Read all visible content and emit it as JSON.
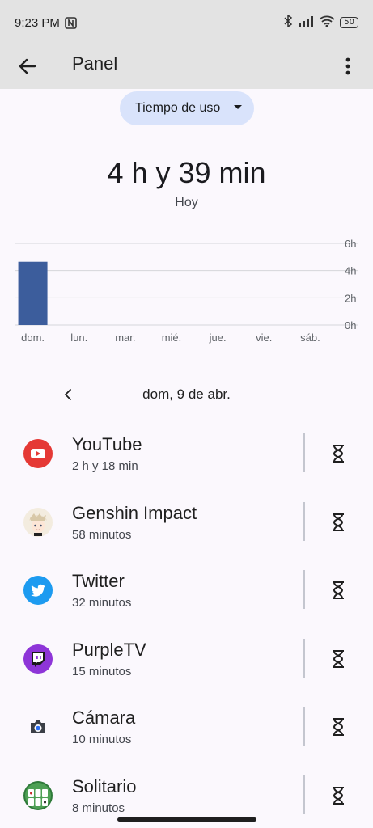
{
  "status_bar": {
    "time": "9:23 PM",
    "battery": "50"
  },
  "app_bar": {
    "title": "Panel"
  },
  "dropdown": {
    "label": "Tiempo de uso"
  },
  "summary": {
    "total": "4 h y 39 min",
    "day": "Hoy"
  },
  "chart_data": {
    "type": "bar",
    "categories": [
      "dom.",
      "lun.",
      "mar.",
      "mié.",
      "jue.",
      "vie.",
      "sáb."
    ],
    "values": [
      4.65,
      0,
      0,
      0,
      0,
      0,
      0
    ],
    "y_ticks": [
      "0h",
      "2h",
      "4h",
      "6h"
    ],
    "ylim": [
      0,
      6
    ],
    "grid": true,
    "bar_color": "#3c5d9c"
  },
  "date_nav": {
    "date": "dom, 9 de abr."
  },
  "apps": [
    {
      "name": "YouTube",
      "usage": "2 h y 18 min",
      "icon": "youtube-icon"
    },
    {
      "name": "Genshin Impact",
      "usage": "58 minutos",
      "icon": "genshin-impact-icon"
    },
    {
      "name": "Twitter",
      "usage": "32 minutos",
      "icon": "twitter-icon"
    },
    {
      "name": "PurpleTV",
      "usage": "15 minutos",
      "icon": "purpletv-icon"
    },
    {
      "name": "Cámara",
      "usage": "10 minutos",
      "icon": "camera-icon"
    },
    {
      "name": "Solitario",
      "usage": "8 minutos",
      "icon": "solitaire-icon"
    }
  ]
}
